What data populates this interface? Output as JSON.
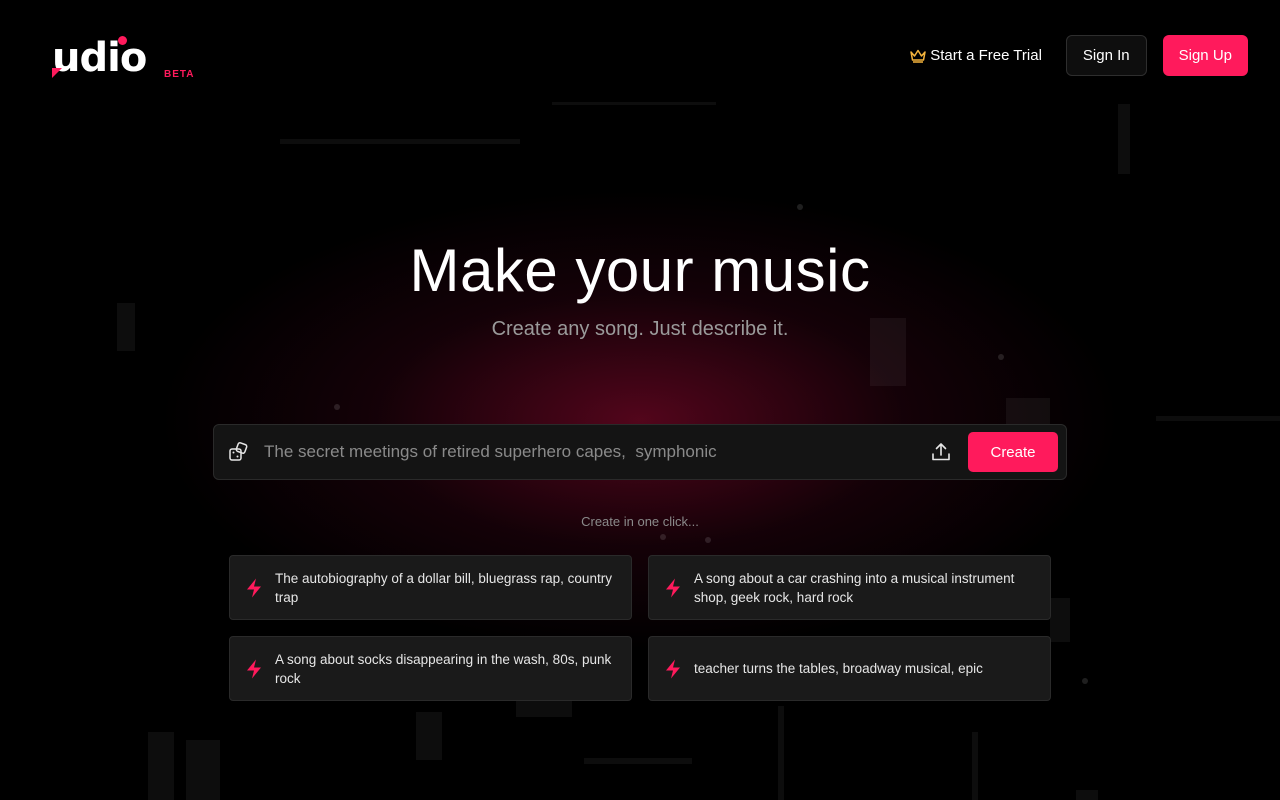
{
  "brand": {
    "name": "udio",
    "badge": "BETA",
    "accent_color": "#ff1a5c"
  },
  "nav": {
    "trial_label": "Start a Free Trial",
    "trial_icon": "crown-icon",
    "signin_label": "Sign In",
    "signup_label": "Sign Up"
  },
  "hero": {
    "title": "Make your music",
    "subtitle": "Create any song. Just describe it."
  },
  "prompt": {
    "placeholder": "The secret meetings of retired superhero capes,  symphonic",
    "value": "",
    "randomize_icon": "dice-icon",
    "upload_icon": "upload-icon",
    "create_label": "Create"
  },
  "suggestions": {
    "heading": "Create in one click...",
    "icon": "lightning-icon",
    "items": [
      {
        "text": "The autobiography of a dollar bill, bluegrass rap, country trap"
      },
      {
        "text": "A song about a car crashing into a musical instrument shop, geek rock, hard rock"
      },
      {
        "text": "A song about socks disappearing in the wash, 80s, punk rock"
      },
      {
        "text": "teacher turns the tables, broadway musical, epic"
      }
    ]
  }
}
